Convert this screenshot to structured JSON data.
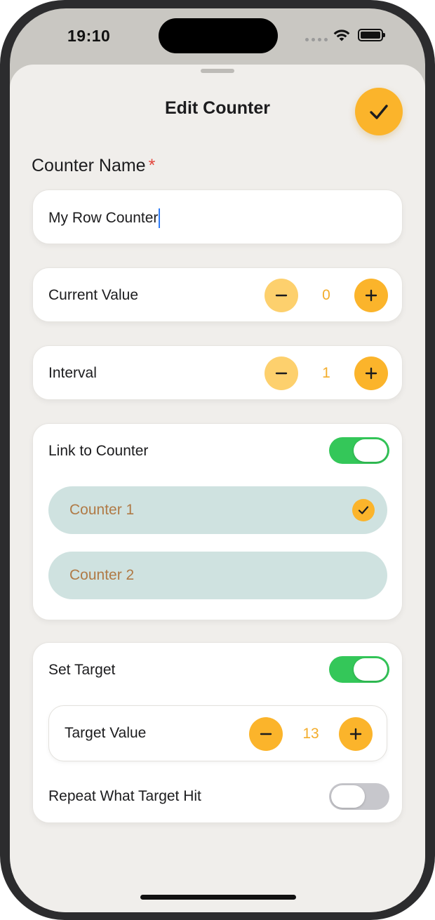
{
  "status": {
    "time": "19:10"
  },
  "sheet": {
    "title": "Edit Counter"
  },
  "name_section": {
    "label": "Counter Name",
    "required_mark": "*",
    "value": "My Row Counter"
  },
  "current_value": {
    "label": "Current Value",
    "value": "0"
  },
  "interval": {
    "label": "Interval",
    "value": "1"
  },
  "link": {
    "label": "Link to Counter",
    "enabled": true,
    "options": [
      {
        "label": "Counter 1",
        "selected": true
      },
      {
        "label": "Counter 2",
        "selected": false
      }
    ]
  },
  "target": {
    "label": "Set Target",
    "enabled": true,
    "value_label": "Target Value",
    "value": "13",
    "repeat_label": "Repeat What Target Hit",
    "repeat_enabled": false
  },
  "colors": {
    "accent": "#fbb42b",
    "toggle_on": "#34c759",
    "toggle_off": "#c7c7cc",
    "option_bg": "#cfe2e0",
    "option_text": "#b07a46",
    "required": "#e2453c"
  },
  "icons": {
    "confirm": "checkmark-icon",
    "minus": "minus-icon",
    "plus": "plus-icon",
    "selected": "checkmark-icon"
  }
}
